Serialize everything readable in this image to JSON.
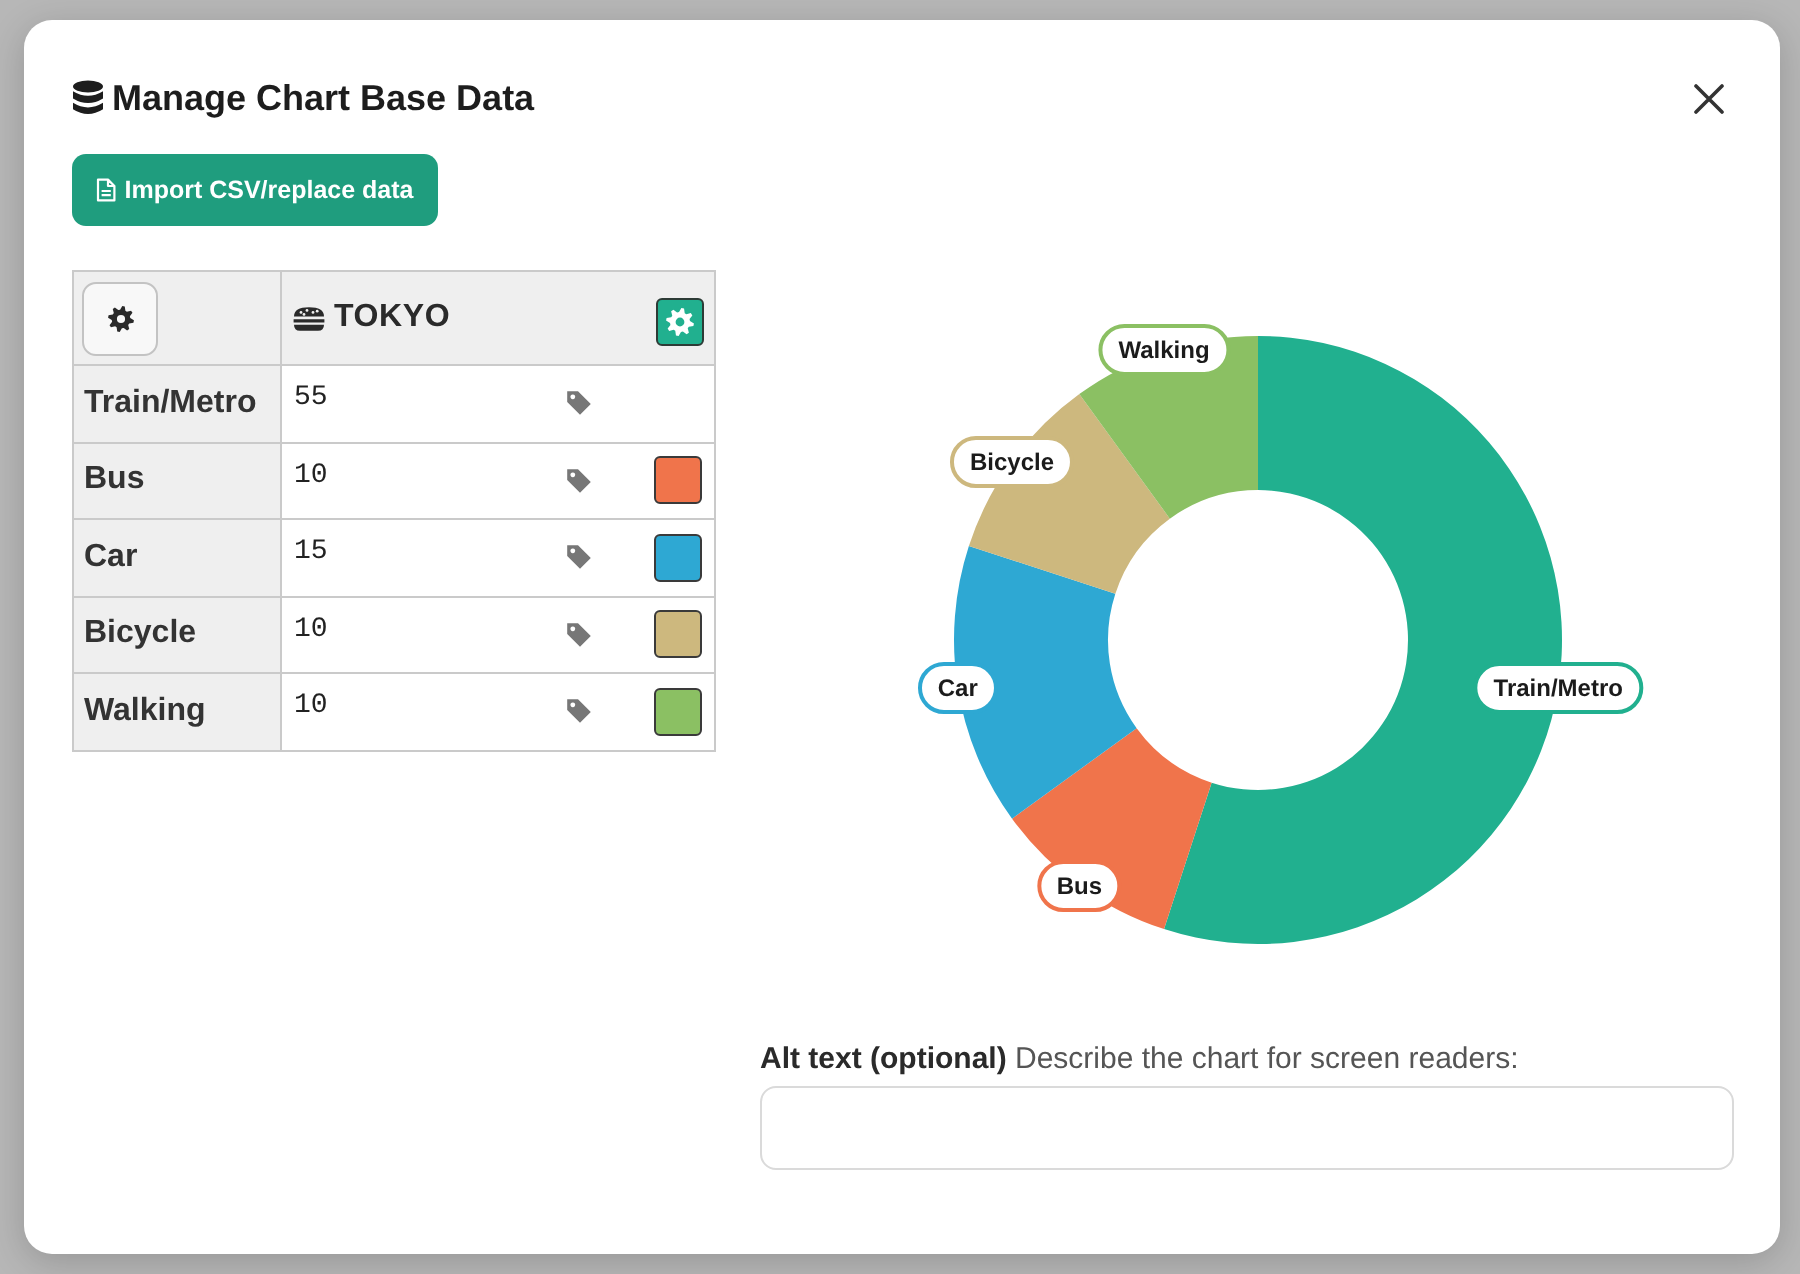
{
  "dialog": {
    "title": "Manage Chart Base Data"
  },
  "import_button": {
    "label": "Import CSV/replace data"
  },
  "table": {
    "series": {
      "name": "TOKYO",
      "color": "#21b08f"
    },
    "rows": [
      {
        "label": "Train/Metro",
        "value": "55"
      },
      {
        "label": "Bus",
        "value": "10",
        "color": "#f0744b"
      },
      {
        "label": "Car",
        "value": "15",
        "color": "#2ea8d3"
      },
      {
        "label": "Bicycle",
        "value": "10",
        "color": "#cdb87e"
      },
      {
        "label": "Walking",
        "value": "10",
        "color": "#8bc063"
      }
    ]
  },
  "chart": {
    "chart_data": {
      "type": "donut",
      "categories": [
        "Train/Metro",
        "Bus",
        "Car",
        "Bicycle",
        "Walking"
      ],
      "series": [
        {
          "values": [
            55,
            10,
            15,
            10,
            10
          ]
        }
      ]
    }
  },
  "alt_text": {
    "label": "**Alt text (optional)** Describe the chart for screen readers:"
  }
}
